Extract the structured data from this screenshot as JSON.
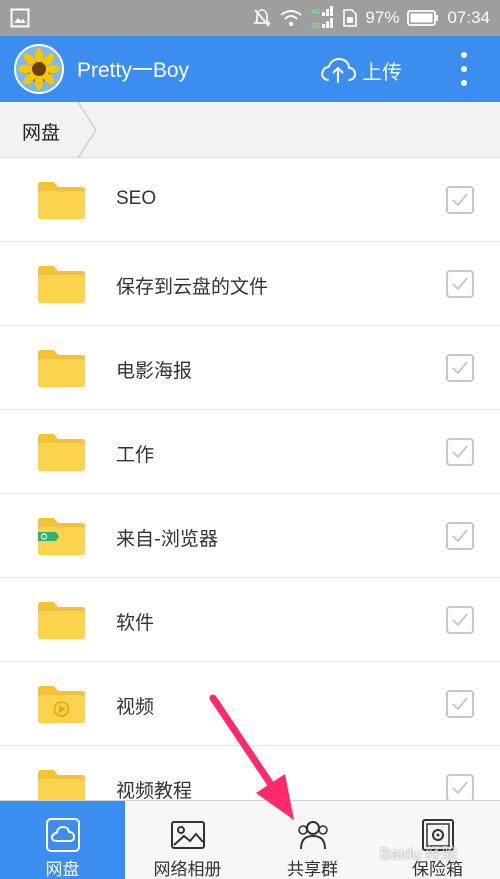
{
  "status_bar": {
    "battery_percent": "97%",
    "time": "07:34",
    "network_labels": [
      "4G",
      "2G"
    ]
  },
  "app_bar": {
    "username": "Pretty一Boy",
    "upload_label": "上传"
  },
  "breadcrumb": {
    "items": [
      "网盘"
    ]
  },
  "files": [
    {
      "name": "SEO",
      "icon": "folder-icon"
    },
    {
      "name": "保存到云盘的文件",
      "icon": "folder-icon"
    },
    {
      "name": "电影海报",
      "icon": "folder-icon"
    },
    {
      "name": "工作",
      "icon": "folder-icon"
    },
    {
      "name": "来自-浏览器",
      "icon": "browser-folder-icon"
    },
    {
      "name": "软件",
      "icon": "folder-icon"
    },
    {
      "name": "视频",
      "icon": "video-folder-icon"
    },
    {
      "name": "视频教程",
      "icon": "folder-icon"
    }
  ],
  "bottom_nav": {
    "items": [
      {
        "label": "网盘",
        "icon": "cloud-drive-icon",
        "active": true
      },
      {
        "label": "网络相册",
        "icon": "photo-album-icon",
        "active": false
      },
      {
        "label": "共享群",
        "icon": "group-share-icon",
        "active": false
      },
      {
        "label": "保险箱",
        "icon": "safe-icon",
        "active": false
      }
    ]
  },
  "colors": {
    "primary": "#3b8df0",
    "folder": "#fbd34d",
    "status_bar": "#9e9e9e",
    "arrow": "#ff2a6a"
  },
  "watermark": "Baidu 经验"
}
